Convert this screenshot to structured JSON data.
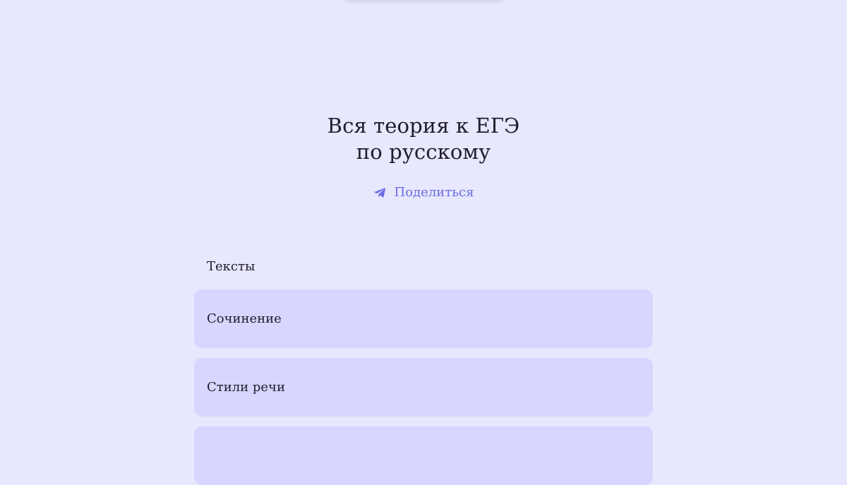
{
  "hero": {
    "title_line_1": "Вся теория к ЕГЭ",
    "title_line_2": "по русскому",
    "share_label": "Поделиться",
    "share_icon": "telegram-paper-plane-icon"
  },
  "section": {
    "title": "Тексты",
    "items": [
      {
        "label": "Сочинение"
      },
      {
        "label": "Стили речи"
      },
      {
        "label": ""
      }
    ]
  },
  "colors": {
    "background": "#e7e7fd",
    "card": "#d8d6ff",
    "accent": "#6b6ee4",
    "text": "#1f1d2b"
  }
}
